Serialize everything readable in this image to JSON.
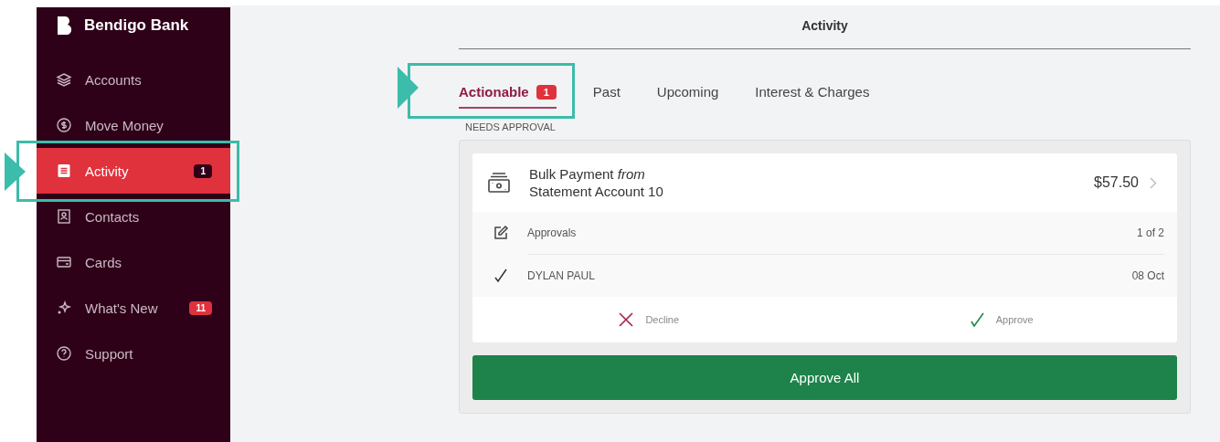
{
  "brand": {
    "name": "Bendigo Bank"
  },
  "sidebar": {
    "items": [
      {
        "label": "Accounts",
        "kind": "layers",
        "selected": false
      },
      {
        "label": "Move Money",
        "kind": "coin",
        "selected": false
      },
      {
        "label": "Activity",
        "kind": "list",
        "selected": true,
        "badge": "1"
      },
      {
        "label": "Contacts",
        "kind": "contact",
        "selected": false
      },
      {
        "label": "Cards",
        "kind": "card",
        "selected": false
      },
      {
        "label": "What's New",
        "kind": "sparkle",
        "selected": false,
        "badge": "11"
      },
      {
        "label": "Support",
        "kind": "help",
        "selected": false
      }
    ]
  },
  "page_title": "Activity",
  "tabs": [
    {
      "label": "Actionable",
      "selected": true,
      "badge": "1"
    },
    {
      "label": "Past",
      "selected": false
    },
    {
      "label": "Upcoming",
      "selected": false
    },
    {
      "label": "Interest & Charges",
      "selected": false
    }
  ],
  "section_label": "NEEDS APPROVAL",
  "payment": {
    "title": "Bulk Payment *from*",
    "account": "Statement Account 10",
    "amount": "$57.50"
  },
  "approvals": {
    "label": "Approvals",
    "count": "1 of 2"
  },
  "approver": {
    "name": "DYLAN PAUL",
    "date": "08 Oct"
  },
  "actions": [
    {
      "label": "Decline",
      "kind": "decline"
    },
    {
      "label": "Approve",
      "kind": "approve"
    }
  ],
  "approve_all": "Approve All"
}
